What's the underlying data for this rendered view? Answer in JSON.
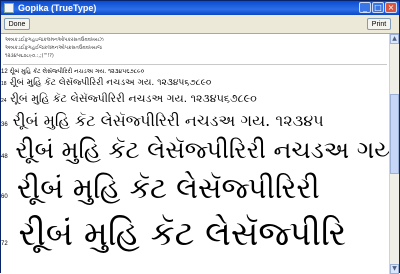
{
  "window": {
    "title": "Gopika (TrueType)",
    "done_label": "Done",
    "print_label": "Print"
  },
  "info_lines": [
    "અબકડઈફગહઇજકલમનઓપકરસતઉવવખયઝ",
    "અબકડઈફગહઈજકલમનઓપક્રસતઉવવખયજ",
    "૧૨૩૪૫૬૭૮૯૦.:,;(\"'!?)"
  ],
  "sample_text": "રીૂબં મુહિ કૅટ લેસૅજ્પીરિરી નચડઅ ગય. ૧૨૩૪૫૬૭૮૯૦",
  "rows": [
    {
      "size": "12",
      "text": "રીૂબં મુહિ કૅટ લેસૅજ્પીરિરી નચડઅ ગય. ૧૨૩૪૫૬૭૮૯૦"
    },
    {
      "size": "18",
      "text": "રીૂબં મુહિ કૅટ લેસૅજ્પીરિરી નચડઅ ગય. ૧૨૩૪૫૬૭૮૯૦"
    },
    {
      "size": "24",
      "text": "રીૂબં મુહિ કૅટ લેસૅજ્પીરિરી નચડઅ ગય. ૧૨૩૪૫૬૭૮૯૦"
    },
    {
      "size": "36",
      "text": "રીૂબં મુહિ કૅટ લેસૅજ્પીરિરી નચડઅ ગય. ૧૨૩૪૫"
    },
    {
      "size": "48",
      "text": "રીૂબં મુહિ કૅટ લેસૅજ્પીરિરી નચડઅ ગય"
    },
    {
      "size": "60",
      "text": "રીૂબં મુહિ કૅટ લેસૅજ્પીરિરી"
    },
    {
      "size": "72",
      "text": "રીૂબં મુહિ કૅટ લેસૅજ્પીરિ"
    }
  ]
}
